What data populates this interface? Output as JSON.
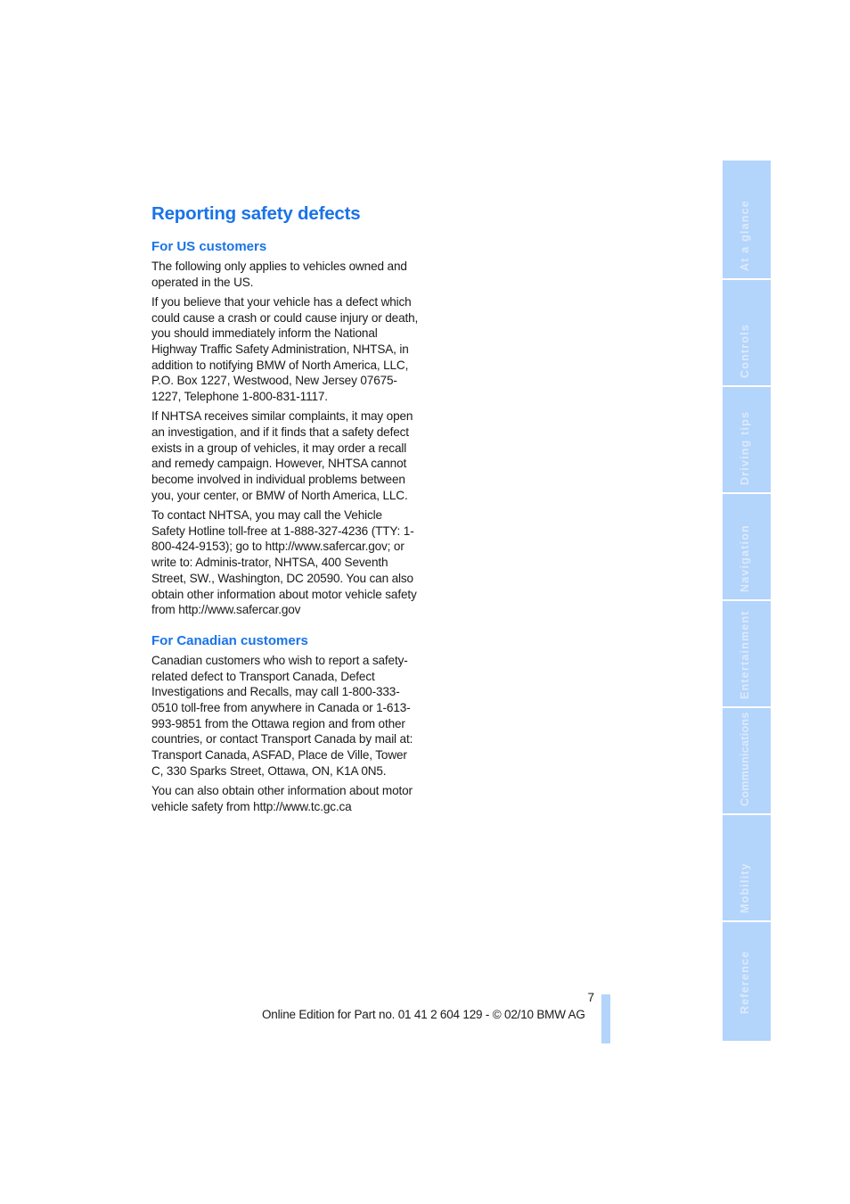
{
  "page": {
    "title": "Reporting safety defects",
    "sections": [
      {
        "heading": "For US customers",
        "paragraphs": [
          "The following only applies to vehicles owned and operated in the US.",
          "If you believe that your vehicle has a defect which could cause a crash or could cause injury or death, you should immediately inform the National Highway Traffic Safety Administration, NHTSA, in addition to notifying BMW of North America, LLC, P.O. Box 1227, Westwood, New Jersey 07675-1227, Telephone 1-800-831-1117.",
          "If NHTSA receives similar complaints, it may open an investigation, and if it finds that a safety defect exists in a group of vehicles, it may order a recall and remedy campaign. However, NHTSA cannot become involved in individual problems between you, your center, or BMW of North America, LLC.",
          "To contact NHTSA, you may call the Vehicle Safety Hotline toll-free at 1-888-327-4236 (TTY: 1-800-424-9153); go to http://www.safercar.gov; or write to: Adminis-trator, NHTSA, 400 Seventh Street, SW., Washington, DC 20590. You can also obtain other information about motor vehicle safety from http://www.safercar.gov"
        ]
      },
      {
        "heading": "For Canadian customers",
        "paragraphs": [
          "Canadian customers who wish to report a safety-related defect to Transport Canada, Defect Investigations and Recalls, may call 1-800-333-0510 toll-free from anywhere in Canada or 1-613-993-9851 from the Ottawa region and from other countries, or contact Transport Canada by mail at: Transport Canada, ASFAD, Place de Ville, Tower C, 330 Sparks Street, Ottawa, ON, K1A 0N5.",
          "You can also obtain other information about motor vehicle safety from http://www.tc.gc.ca"
        ]
      }
    ]
  },
  "sidebar": {
    "tabs": [
      {
        "label": "At a glance"
      },
      {
        "label": "Controls"
      },
      {
        "label": "Driving tips"
      },
      {
        "label": "Navigation"
      },
      {
        "label": "Entertainment"
      },
      {
        "label": "Communications"
      },
      {
        "label": "Mobility"
      },
      {
        "label": "Reference"
      }
    ]
  },
  "footer": {
    "page_number": "7",
    "edition_text": "Online Edition for Part no. 01 41 2 604 129 - © 02/10 BMW AG"
  },
  "colors": {
    "accent": "#1a73e8",
    "tab_bg": "#b3d4fb",
    "tab_text": "#dceafd"
  }
}
